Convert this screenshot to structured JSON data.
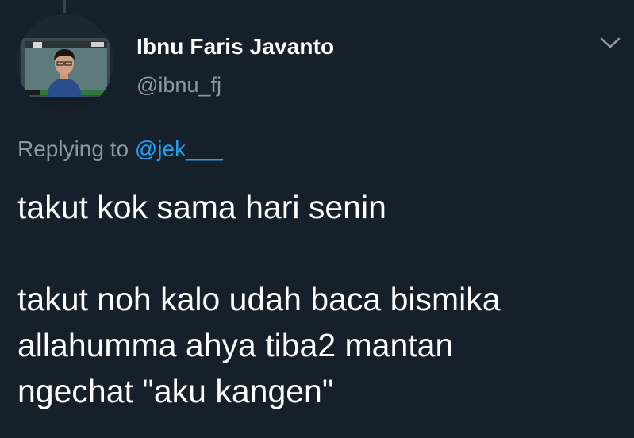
{
  "tweet": {
    "author": {
      "display_name": "Ibnu Faris Javanto",
      "handle": "@ibnu_fj",
      "avatar_icon": "profile-photo"
    },
    "reply": {
      "prefix": "Replying to",
      "mention": "@jek___"
    },
    "text_lines": [
      "takut kok sama hari senin",
      "",
      "takut noh kalo udah baca bismika",
      "allahumma ahya tiba2 mantan",
      "ngechat \"aku kangen\""
    ],
    "menu_icon": "chevron-down-icon"
  },
  "colors": {
    "background": "#15202b",
    "primary_text": "#ffffff",
    "secondary_text": "#8899a6",
    "accent": "#1da1f2"
  }
}
